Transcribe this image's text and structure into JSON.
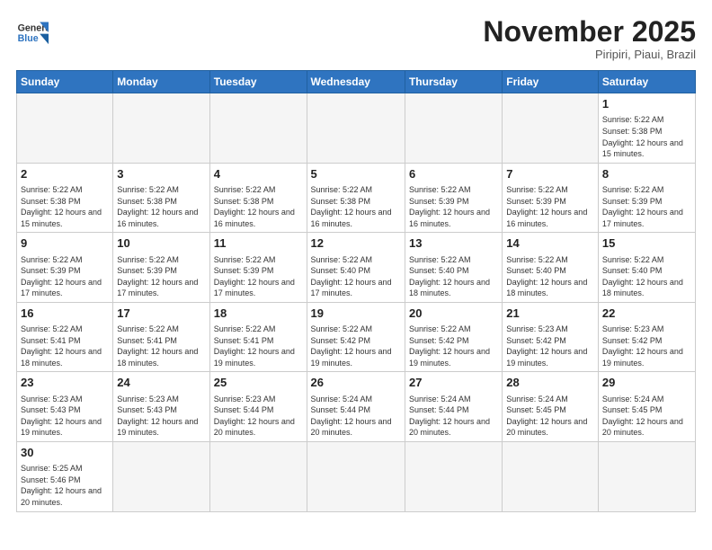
{
  "logo": {
    "text_general": "General",
    "text_blue": "Blue"
  },
  "header": {
    "month": "November 2025",
    "location": "Piripiri, Piaui, Brazil"
  },
  "days_of_week": [
    "Sunday",
    "Monday",
    "Tuesday",
    "Wednesday",
    "Thursday",
    "Friday",
    "Saturday"
  ],
  "weeks": [
    [
      {
        "day": "",
        "empty": true
      },
      {
        "day": "",
        "empty": true
      },
      {
        "day": "",
        "empty": true
      },
      {
        "day": "",
        "empty": true
      },
      {
        "day": "",
        "empty": true
      },
      {
        "day": "",
        "empty": true
      },
      {
        "day": "1",
        "info": "Sunrise: 5:22 AM\nSunset: 5:38 PM\nDaylight: 12 hours and 15 minutes."
      }
    ],
    [
      {
        "day": "2",
        "info": "Sunrise: 5:22 AM\nSunset: 5:38 PM\nDaylight: 12 hours and 15 minutes."
      },
      {
        "day": "3",
        "info": "Sunrise: 5:22 AM\nSunset: 5:38 PM\nDaylight: 12 hours and 16 minutes."
      },
      {
        "day": "4",
        "info": "Sunrise: 5:22 AM\nSunset: 5:38 PM\nDaylight: 12 hours and 16 minutes."
      },
      {
        "day": "5",
        "info": "Sunrise: 5:22 AM\nSunset: 5:38 PM\nDaylight: 12 hours and 16 minutes."
      },
      {
        "day": "6",
        "info": "Sunrise: 5:22 AM\nSunset: 5:39 PM\nDaylight: 12 hours and 16 minutes."
      },
      {
        "day": "7",
        "info": "Sunrise: 5:22 AM\nSunset: 5:39 PM\nDaylight: 12 hours and 16 minutes."
      },
      {
        "day": "8",
        "info": "Sunrise: 5:22 AM\nSunset: 5:39 PM\nDaylight: 12 hours and 17 minutes."
      }
    ],
    [
      {
        "day": "9",
        "info": "Sunrise: 5:22 AM\nSunset: 5:39 PM\nDaylight: 12 hours and 17 minutes."
      },
      {
        "day": "10",
        "info": "Sunrise: 5:22 AM\nSunset: 5:39 PM\nDaylight: 12 hours and 17 minutes."
      },
      {
        "day": "11",
        "info": "Sunrise: 5:22 AM\nSunset: 5:39 PM\nDaylight: 12 hours and 17 minutes."
      },
      {
        "day": "12",
        "info": "Sunrise: 5:22 AM\nSunset: 5:40 PM\nDaylight: 12 hours and 17 minutes."
      },
      {
        "day": "13",
        "info": "Sunrise: 5:22 AM\nSunset: 5:40 PM\nDaylight: 12 hours and 18 minutes."
      },
      {
        "day": "14",
        "info": "Sunrise: 5:22 AM\nSunset: 5:40 PM\nDaylight: 12 hours and 18 minutes."
      },
      {
        "day": "15",
        "info": "Sunrise: 5:22 AM\nSunset: 5:40 PM\nDaylight: 12 hours and 18 minutes."
      }
    ],
    [
      {
        "day": "16",
        "info": "Sunrise: 5:22 AM\nSunset: 5:41 PM\nDaylight: 12 hours and 18 minutes."
      },
      {
        "day": "17",
        "info": "Sunrise: 5:22 AM\nSunset: 5:41 PM\nDaylight: 12 hours and 18 minutes."
      },
      {
        "day": "18",
        "info": "Sunrise: 5:22 AM\nSunset: 5:41 PM\nDaylight: 12 hours and 19 minutes."
      },
      {
        "day": "19",
        "info": "Sunrise: 5:22 AM\nSunset: 5:42 PM\nDaylight: 12 hours and 19 minutes."
      },
      {
        "day": "20",
        "info": "Sunrise: 5:22 AM\nSunset: 5:42 PM\nDaylight: 12 hours and 19 minutes."
      },
      {
        "day": "21",
        "info": "Sunrise: 5:23 AM\nSunset: 5:42 PM\nDaylight: 12 hours and 19 minutes."
      },
      {
        "day": "22",
        "info": "Sunrise: 5:23 AM\nSunset: 5:42 PM\nDaylight: 12 hours and 19 minutes."
      }
    ],
    [
      {
        "day": "23",
        "info": "Sunrise: 5:23 AM\nSunset: 5:43 PM\nDaylight: 12 hours and 19 minutes."
      },
      {
        "day": "24",
        "info": "Sunrise: 5:23 AM\nSunset: 5:43 PM\nDaylight: 12 hours and 19 minutes."
      },
      {
        "day": "25",
        "info": "Sunrise: 5:23 AM\nSunset: 5:44 PM\nDaylight: 12 hours and 20 minutes."
      },
      {
        "day": "26",
        "info": "Sunrise: 5:24 AM\nSunset: 5:44 PM\nDaylight: 12 hours and 20 minutes."
      },
      {
        "day": "27",
        "info": "Sunrise: 5:24 AM\nSunset: 5:44 PM\nDaylight: 12 hours and 20 minutes."
      },
      {
        "day": "28",
        "info": "Sunrise: 5:24 AM\nSunset: 5:45 PM\nDaylight: 12 hours and 20 minutes."
      },
      {
        "day": "29",
        "info": "Sunrise: 5:24 AM\nSunset: 5:45 PM\nDaylight: 12 hours and 20 minutes."
      }
    ],
    [
      {
        "day": "30",
        "info": "Sunrise: 5:25 AM\nSunset: 5:46 PM\nDaylight: 12 hours and 20 minutes."
      },
      {
        "day": "",
        "empty": true
      },
      {
        "day": "",
        "empty": true
      },
      {
        "day": "",
        "empty": true
      },
      {
        "day": "",
        "empty": true
      },
      {
        "day": "",
        "empty": true
      },
      {
        "day": "",
        "empty": true
      }
    ]
  ]
}
